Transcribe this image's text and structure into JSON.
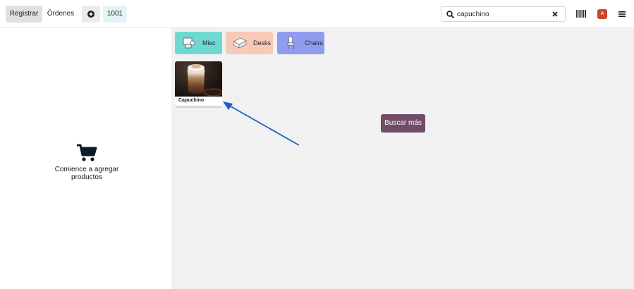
{
  "topbar": {
    "register_label": "Registrar",
    "orders_label": "Órdenes",
    "order_number": "1001"
  },
  "search": {
    "value": "capuchino"
  },
  "user": {
    "avatar_letter": "A",
    "avatar_color": "#c8482b"
  },
  "cart": {
    "empty_message": "Comience a agregar productos"
  },
  "categories": [
    {
      "label": "Misc",
      "color": "#6fd9d1",
      "icon": "misc-icon"
    },
    {
      "label": "Desks",
      "color": "#f7c9b8",
      "icon": "desk-icon"
    },
    {
      "label": "Chairs",
      "color": "#8f9cf0",
      "icon": "chair-icon"
    }
  ],
  "products": [
    {
      "name": "Capuchino",
      "image": "cappuccino-photo"
    }
  ],
  "actions": {
    "search_more_label": "Buscar más",
    "search_more_color": "#714b67"
  },
  "annotation": {
    "arrow_color": "#1a5fc4"
  }
}
